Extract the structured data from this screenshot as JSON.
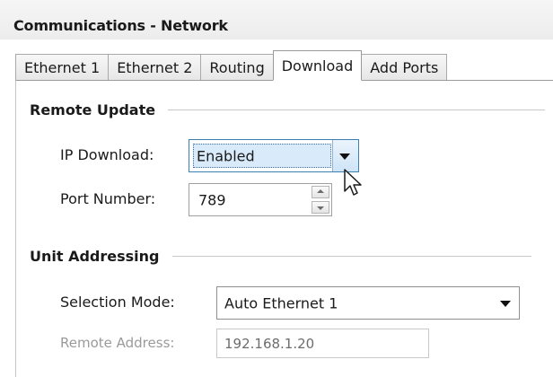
{
  "window": {
    "title": "Communications - Network"
  },
  "tabs": [
    {
      "label": "Ethernet 1",
      "active": false
    },
    {
      "label": "Ethernet 2",
      "active": false
    },
    {
      "label": "Routing",
      "active": false
    },
    {
      "label": "Download",
      "active": true
    },
    {
      "label": "Add Ports",
      "active": false
    }
  ],
  "remote_update": {
    "heading": "Remote Update",
    "ip_download_label": "IP Download:",
    "ip_download_value": "Enabled",
    "port_number_label": "Port Number:",
    "port_number_value": "789"
  },
  "unit_addressing": {
    "heading": "Unit Addressing",
    "selection_mode_label": "Selection Mode:",
    "selection_mode_value": "Auto Ethernet 1",
    "remote_address_label": "Remote Address:",
    "remote_address_value": "192.168.1.20"
  },
  "icons": {
    "dropdown": "chevron-down-icon",
    "spin_up": "spin-up-icon",
    "spin_down": "spin-down-icon",
    "cursor": "mouse-pointer-icon"
  },
  "colors": {
    "focus_border": "#3c7fb1",
    "focus_fill": "#d9eafb",
    "disabled_text": "#9a9a9a"
  }
}
